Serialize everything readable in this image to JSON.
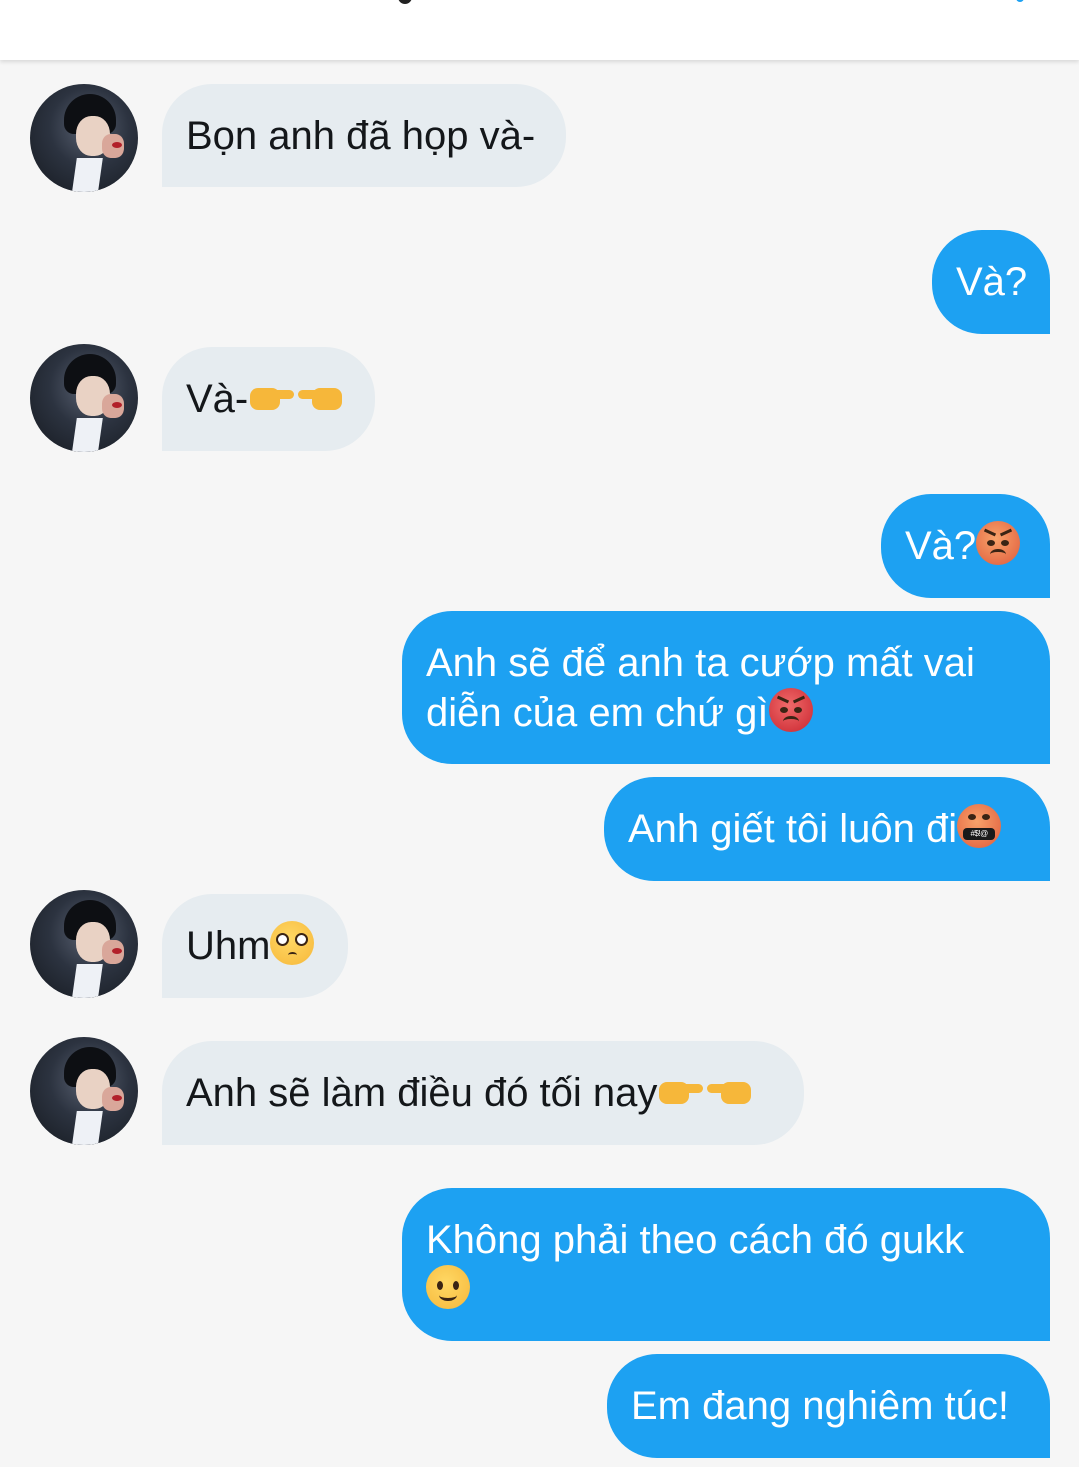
{
  "header": {
    "title": ""
  },
  "colors": {
    "outgoing_bubble": "#1da1f2",
    "incoming_bubble": "#e6ecf0",
    "background": "#f6f6f6"
  },
  "messages": [
    {
      "direction": "in",
      "text": "Bọn anh đã họp và-",
      "emoji": []
    },
    {
      "direction": "out",
      "text": "Và?",
      "emoji": []
    },
    {
      "direction": "in",
      "text": "Và-",
      "emoji": [
        "backhand-index-pointing-right-icon",
        "backhand-index-pointing-left-icon"
      ]
    },
    {
      "direction": "out",
      "text": "Và?",
      "emoji": [
        "angry-face-icon"
      ]
    },
    {
      "direction": "out",
      "text": "Anh sẽ để anh ta cướp mất vai diễn của em chứ gì",
      "emoji": [
        "angry-face-icon"
      ]
    },
    {
      "direction": "out",
      "text": "Anh giết tôi luôn đi",
      "emoji": [
        "cursing-face-icon"
      ]
    },
    {
      "direction": "in",
      "text": "Uhm",
      "emoji": [
        "pleading-face-icon"
      ]
    },
    {
      "direction": "in",
      "text": "Anh sẽ làm điều đó tối nay",
      "emoji": [
        "backhand-index-pointing-right-icon",
        "backhand-index-pointing-left-icon"
      ]
    },
    {
      "direction": "out",
      "text": "Không phải theo cách đó gukk",
      "emoji": [
        "slightly-smiling-face-icon"
      ]
    },
    {
      "direction": "out",
      "text": "Em đang nghiêm túc!",
      "emoji": []
    }
  ],
  "emoji_glyphs": {
    "cursing_face_symbols": "#$!@"
  }
}
